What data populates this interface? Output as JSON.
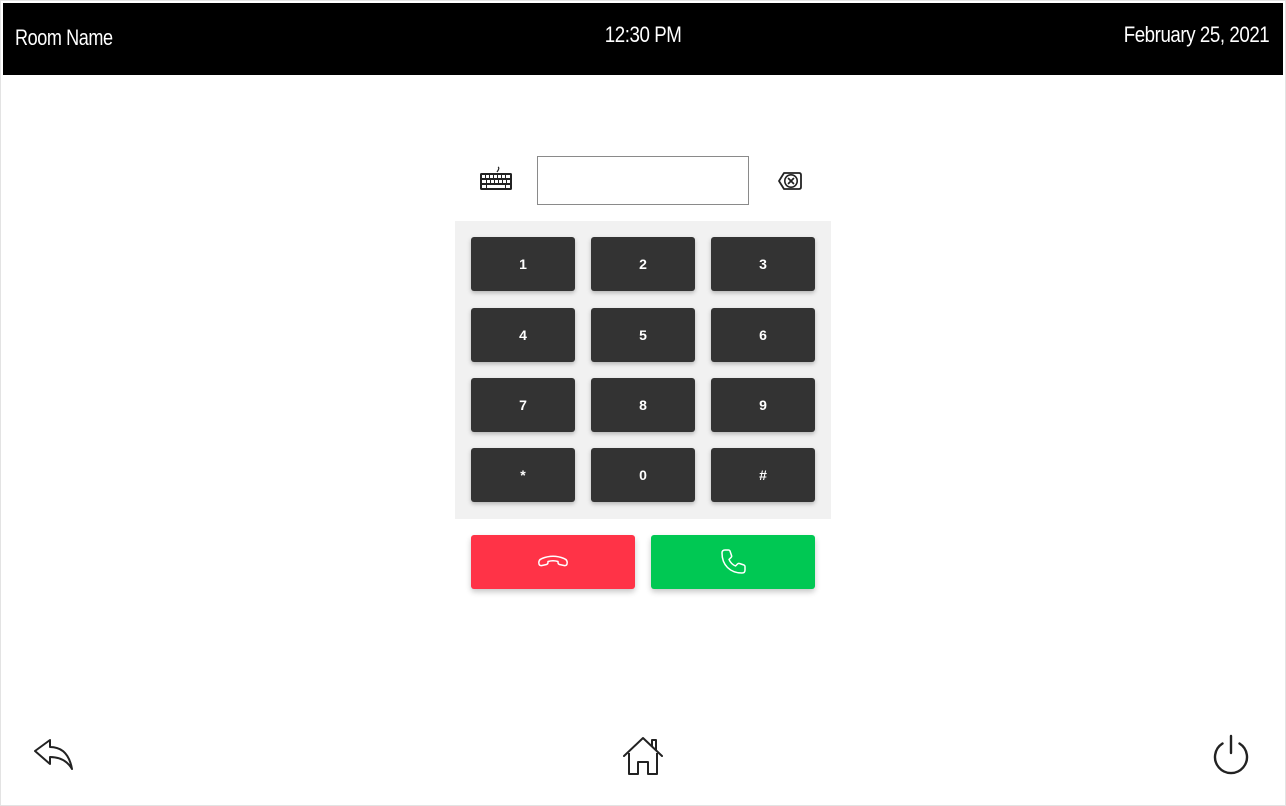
{
  "header": {
    "room_name": "Room Name",
    "time": "12:30 PM",
    "date": "February 25, 2021"
  },
  "dialer": {
    "input_value": "",
    "keys": [
      "1",
      "2",
      "3",
      "4",
      "5",
      "6",
      "7",
      "8",
      "9",
      "*",
      "0",
      "#"
    ],
    "keyboard_icon": "keyboard-icon",
    "backspace_icon": "backspace-icon"
  },
  "call_controls": {
    "hangup_icon": "phone-hangup-icon",
    "answer_icon": "phone-call-icon",
    "hangup_color": "#ff3347",
    "answer_color": "#00c853"
  },
  "footer": {
    "back_icon": "back-arrow-icon",
    "home_icon": "home-icon",
    "power_icon": "power-icon"
  },
  "colors": {
    "header_bg": "#000000",
    "key_bg": "#333333",
    "keypad_bg": "#f1f1f1"
  }
}
